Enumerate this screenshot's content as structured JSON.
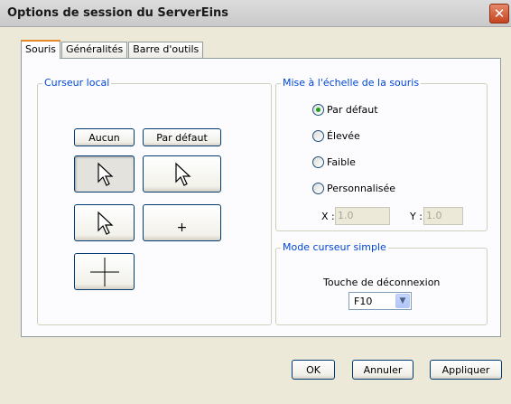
{
  "window": {
    "title": "Options de session du ServerEins",
    "close_symbol": "✕"
  },
  "tabs": [
    {
      "label": "Souris",
      "active": true
    },
    {
      "label": "Généralités",
      "active": false
    },
    {
      "label": "Barre d'outils",
      "active": false
    }
  ],
  "local_cursor": {
    "label": "Curseur local",
    "none_button": "Aucun",
    "default_button": "Par défaut",
    "cursor_choices": [
      {
        "icon": "arrow-cursor-icon",
        "selected": true
      },
      {
        "icon": "arrow-cursor-icon",
        "selected": false
      },
      {
        "icon": "arrow-cursor-icon",
        "selected": false
      },
      {
        "icon": "small-crosshair-icon",
        "selected": false,
        "glyph": "+"
      },
      {
        "icon": "large-crosshair-icon",
        "selected": false
      }
    ]
  },
  "mouse_scaling": {
    "label": "Mise à l'échelle de la souris",
    "options": [
      {
        "label": "Par défaut",
        "checked": true
      },
      {
        "label": "Élevée",
        "checked": false
      },
      {
        "label": "Faible",
        "checked": false
      },
      {
        "label": "Personnalisée",
        "checked": false
      }
    ],
    "x_label": "X :",
    "x_value": "1.0",
    "y_label": "Y :",
    "y_value": "1.0"
  },
  "simple_cursor": {
    "label": "Mode curseur simple",
    "hotkey_label": "Touche de déconnexion",
    "hotkey_value": "F10"
  },
  "footer": {
    "ok": "OK",
    "cancel": "Annuler",
    "apply": "Appliquer"
  }
}
